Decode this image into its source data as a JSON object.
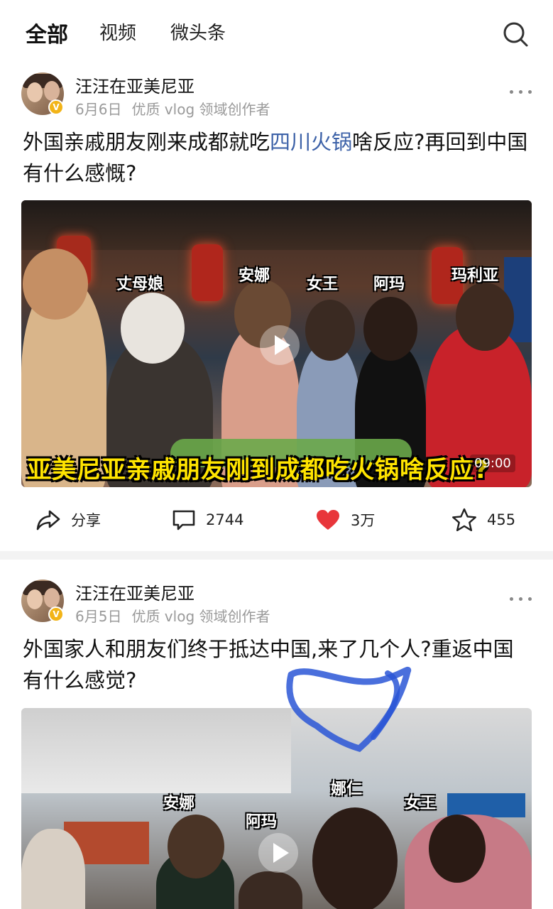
{
  "nav": {
    "tabs": [
      "全部",
      "视频",
      "微头条"
    ],
    "active_tab": "全部",
    "search_icon": "search-icon"
  },
  "posts": [
    {
      "author": "汪汪在亚美尼亚",
      "date": "6月6日",
      "creator_label": "优质 vlog 领域创作者",
      "title_before": "外国亲戚朋友刚来成都就吃",
      "title_link": "四川火锅",
      "title_after": "啥反应?再回到中国有什么感慨?",
      "video": {
        "duration": "09:00",
        "caption": "亚美尼亚亲戚朋友刚到成都吃火锅啥反应?",
        "tags": [
          "丈母娘",
          "安娜",
          "女王",
          "阿玛",
          "玛利亚"
        ]
      },
      "actions": {
        "share": "分享",
        "comments": "2744",
        "likes": "3万",
        "favorites": "455"
      }
    },
    {
      "author": "汪汪在亚美尼亚",
      "date": "6月5日",
      "creator_label": "优质 vlog 领域创作者",
      "title": "外国家人和朋友们终于抵达中国,来了几个人?重返中国有什么感觉?",
      "video": {
        "tags": [
          "娜仁",
          "安娜",
          "女王",
          "阿玛"
        ]
      }
    }
  ],
  "colors": {
    "link": "#3d62a8",
    "like_heart": "#e8363b",
    "verified_badge": "#f2b418",
    "caption_yellow": "#ffe400"
  }
}
